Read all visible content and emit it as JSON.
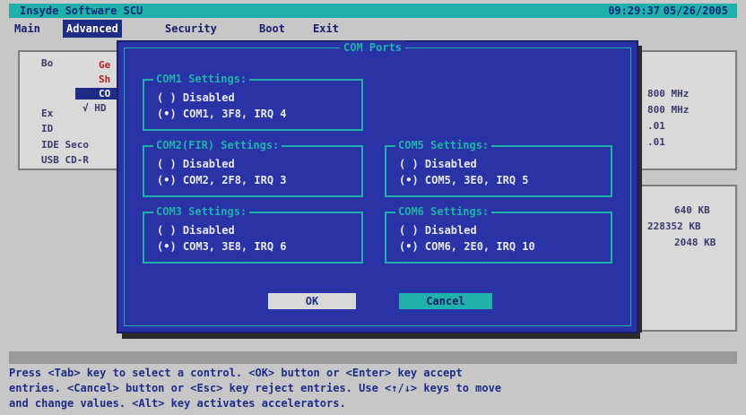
{
  "titlebar": {
    "app_name": "Insyde Software SCU",
    "time": "09:29:37",
    "date": "05/26/2005"
  },
  "menu": {
    "items": [
      "Main",
      "Advanced",
      "Security",
      "Boot",
      "Exit"
    ],
    "active_index": 1
  },
  "background": {
    "left_panel_header": "Bo",
    "left_items": [
      "Ge",
      "Sh",
      "CO",
      "√ HD"
    ],
    "left_rows": [
      "Ex",
      "ID",
      "IDE Seco",
      "USB CD-R"
    ],
    "right_freqs": [
      "800 MHz",
      "800 MHz",
      ".01",
      ".01"
    ],
    "right_mem": [
      "640 KB",
      "228352 KB",
      "2048 KB"
    ]
  },
  "dialog": {
    "title": "COM Ports",
    "groups": [
      {
        "title": "COM1 Settings:",
        "opt1": "( ) Disabled",
        "opt2": "(•) COM1, 3F8, IRQ 4"
      },
      {
        "title": "COM2(FIR) Settings:",
        "opt1": "( ) Disabled",
        "opt2": "(•) COM2, 2F8, IRQ 3"
      },
      {
        "title": "COM5 Settings:",
        "opt1": "( ) Disabled",
        "opt2": "(•) COM5, 3E0, IRQ 5"
      },
      {
        "title": "COM3 Settings:",
        "opt1": "( ) Disabled",
        "opt2": "(•) COM3, 3E8, IRQ 6"
      },
      {
        "title": "COM6 Settings:",
        "opt1": "( ) Disabled",
        "opt2": "(•) COM6, 2E0, IRQ 10"
      }
    ],
    "ok_label": "OK",
    "cancel_label": "Cancel"
  },
  "help": {
    "line1": "Press <Tab> key to select a control. <OK> button or <Enter> key accept",
    "line2": "entries. <Cancel> button or <Esc> key reject entries. Use <↑/↓> keys to move",
    "line3": "and change values. <Alt> key activates accelerators."
  },
  "colors": {
    "title_bg": "#20b2aa",
    "dialog_bg": "#2a33a6",
    "accent": "#20b2aa",
    "menu_active_bg": "#1f2c86"
  }
}
